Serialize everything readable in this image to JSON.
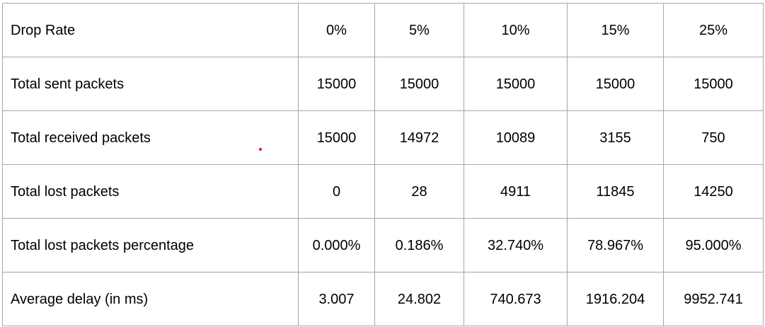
{
  "table": {
    "rows": [
      {
        "label": "Drop Rate",
        "values": [
          "0%",
          "5%",
          "10%",
          "15%",
          "25%"
        ]
      },
      {
        "label": "Total sent packets",
        "values": [
          "15000",
          "15000",
          "15000",
          "15000",
          "15000"
        ]
      },
      {
        "label": "Total received packets",
        "values": [
          "15000",
          "14972",
          "10089",
          "3155",
          "750"
        ]
      },
      {
        "label": "Total lost packets",
        "values": [
          "0",
          "28",
          "4911",
          "11845",
          "14250"
        ]
      },
      {
        "label": "Total lost packets percentage",
        "values": [
          "0.000%",
          "0.186%",
          "32.740%",
          "78.967%",
          "95.000%"
        ]
      },
      {
        "label": "Average delay (in ms)",
        "values": [
          "3.007",
          "24.802",
          "740.673",
          "1916.204",
          "9952.741"
        ]
      }
    ]
  },
  "colors": {
    "border": "#a6a6a6",
    "text": "#000000",
    "marker": "#e0121b"
  }
}
